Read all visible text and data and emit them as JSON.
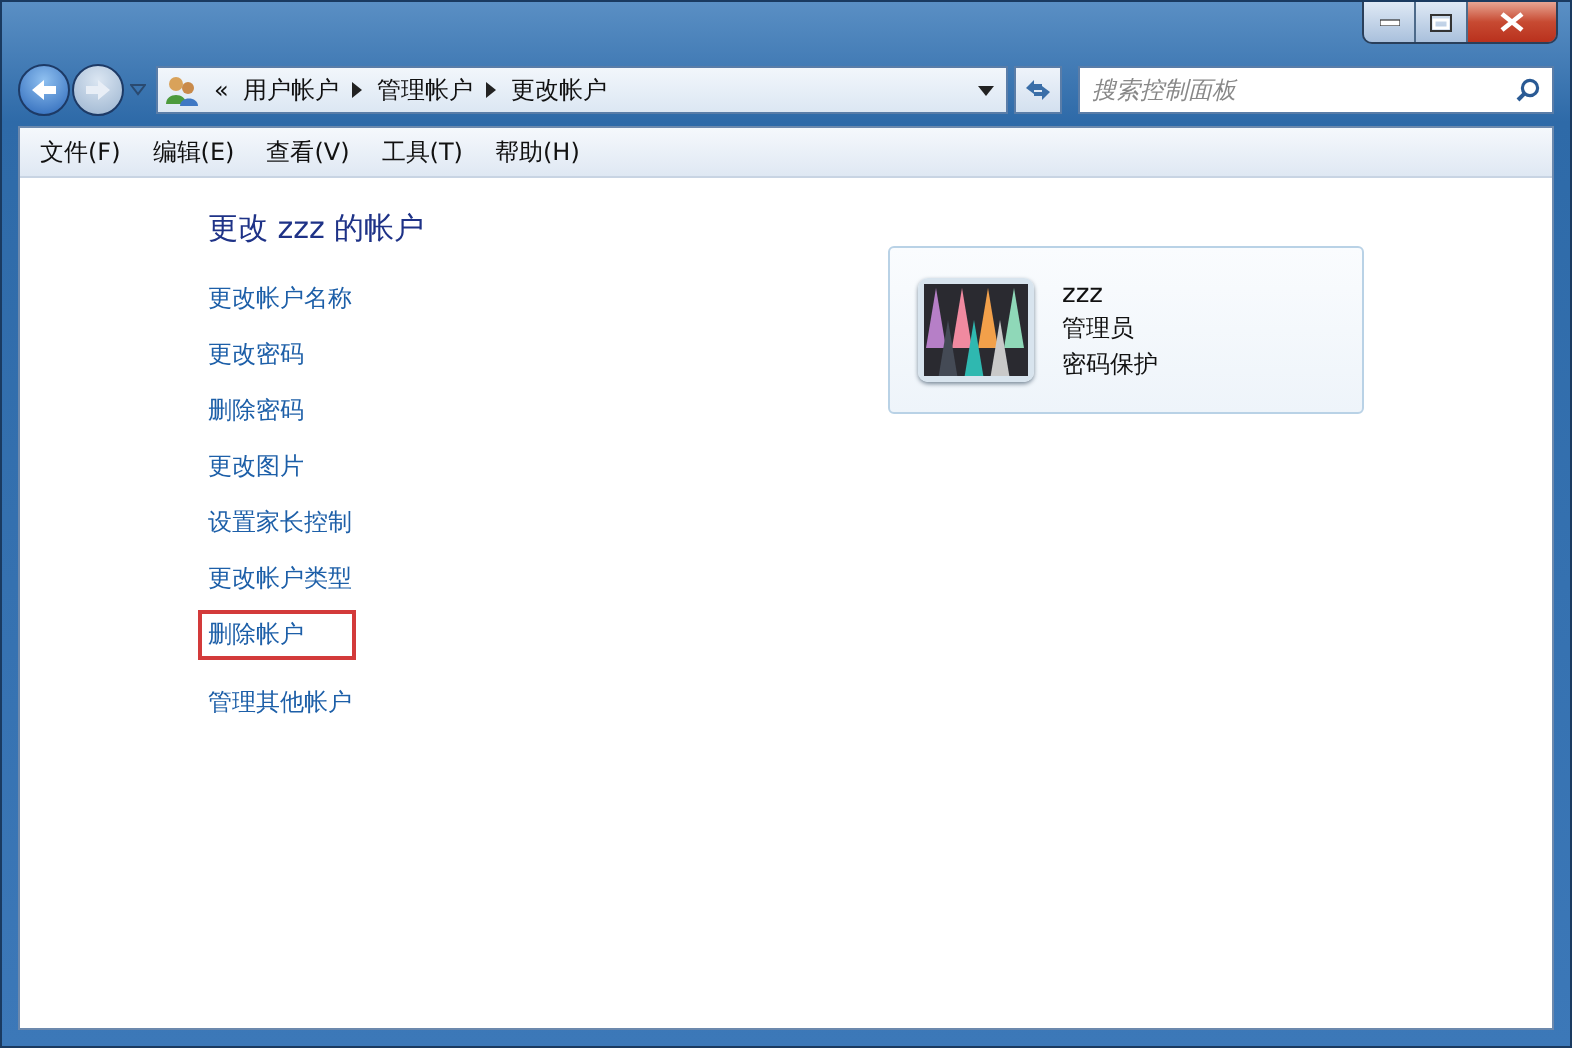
{
  "window": {
    "caption_buttons": [
      {
        "kind": "minimize"
      },
      {
        "kind": "maximize"
      },
      {
        "kind": "close"
      }
    ]
  },
  "breadcrumb": {
    "overflow": "«",
    "items": [
      "用户帐户",
      "管理帐户",
      "更改帐户"
    ]
  },
  "search": {
    "placeholder": "搜索控制面板"
  },
  "menu": [
    "文件(F)",
    "编辑(E)",
    "查看(V)",
    "工具(T)",
    "帮助(H)"
  ],
  "heading": "更改 zzz 的帐户",
  "tasks": [
    {
      "label": "更改帐户名称",
      "highlighted": false
    },
    {
      "label": "更改密码",
      "highlighted": false
    },
    {
      "label": "删除密码",
      "highlighted": false
    },
    {
      "label": "更改图片",
      "highlighted": false
    },
    {
      "label": "设置家长控制",
      "highlighted": false
    },
    {
      "label": "更改帐户类型",
      "highlighted": false
    },
    {
      "label": "删除帐户",
      "highlighted": true
    },
    {
      "label": "管理其他帐户",
      "highlighted": false
    }
  ],
  "account": {
    "name": "zzz",
    "type": "管理员",
    "status": "密码保护"
  }
}
